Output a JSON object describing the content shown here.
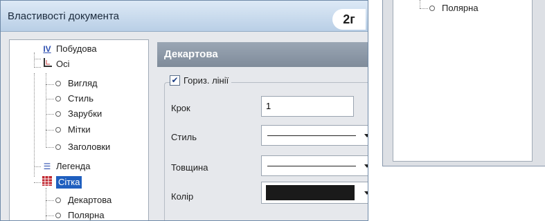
{
  "dialog": {
    "title": "Властивості документа",
    "badge": "2г"
  },
  "tree": {
    "items": [
      {
        "label": "Побудова",
        "icon": "IV"
      },
      {
        "label": "Осі",
        "icon": "axes"
      },
      {
        "label": "Вигляд"
      },
      {
        "label": "Стиль"
      },
      {
        "label": "Зарубки"
      },
      {
        "label": "Мітки"
      },
      {
        "label": "Заголовки"
      },
      {
        "label": "Легенда",
        "icon": "legend"
      },
      {
        "label": "Сітка",
        "icon": "grid"
      },
      {
        "label": "Декартова"
      },
      {
        "label": "Полярна"
      }
    ],
    "selected": "Сітка"
  },
  "panel": {
    "title": "Декартова",
    "checkbox_label": "Гориз. лінії",
    "checkbox_checked": true,
    "step_label": "Крок",
    "step_value": "1",
    "style_label": "Стиль",
    "thickness_label": "Товщина",
    "color_label": "Колір",
    "color_value": "#1a1a1a"
  },
  "dialog2": {
    "tree_item": "Полярна"
  }
}
